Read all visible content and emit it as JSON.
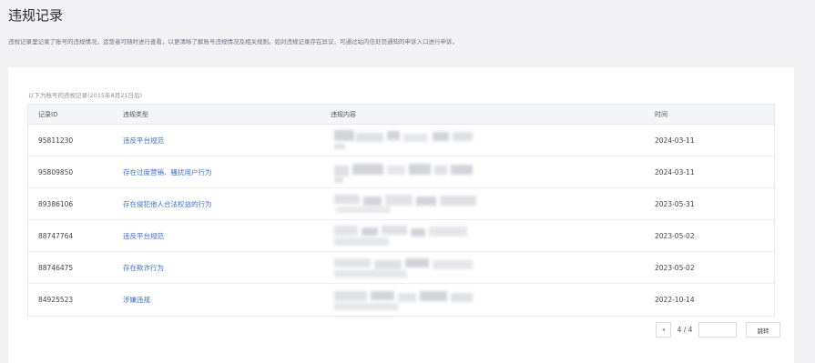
{
  "page": {
    "title": "违规记录",
    "description": "违规记录里记录了账号的违规情况，运营者可随时进行查看，以更清晰了解账号违规情况及相关规则。如对违规记录存在异议，可通过站内信处罚通知的申诉入口进行申诉。"
  },
  "card": {
    "note": "以下为账号的违规记录(2015年8月21日后)"
  },
  "table": {
    "headers": {
      "id": "记录ID",
      "type": "违规类型",
      "content": "违规内容",
      "time": "时间"
    },
    "rows": [
      {
        "id": "95811230",
        "type": "违反平台规范",
        "time": "2024-03-11"
      },
      {
        "id": "95809850",
        "type": "存在过度营销、骚扰用户行为",
        "time": "2024-03-11"
      },
      {
        "id": "89386106",
        "type": "存在侵犯他人合法权益的行为",
        "time": "2023-05-31"
      },
      {
        "id": "88747764",
        "type": "违反平台规范",
        "time": "2023-05-02"
      },
      {
        "id": "88746475",
        "type": "存在欺诈行为",
        "time": "2023-05-02"
      },
      {
        "id": "84925523",
        "type": "涉嫌违规",
        "time": "2022-10-14"
      }
    ]
  },
  "pagination": {
    "prev_icon": "chevron-left-icon",
    "prev_glyph": "◂",
    "info": "4 / 4",
    "input_value": "",
    "input_placeholder": "",
    "go_label": "跳转"
  }
}
